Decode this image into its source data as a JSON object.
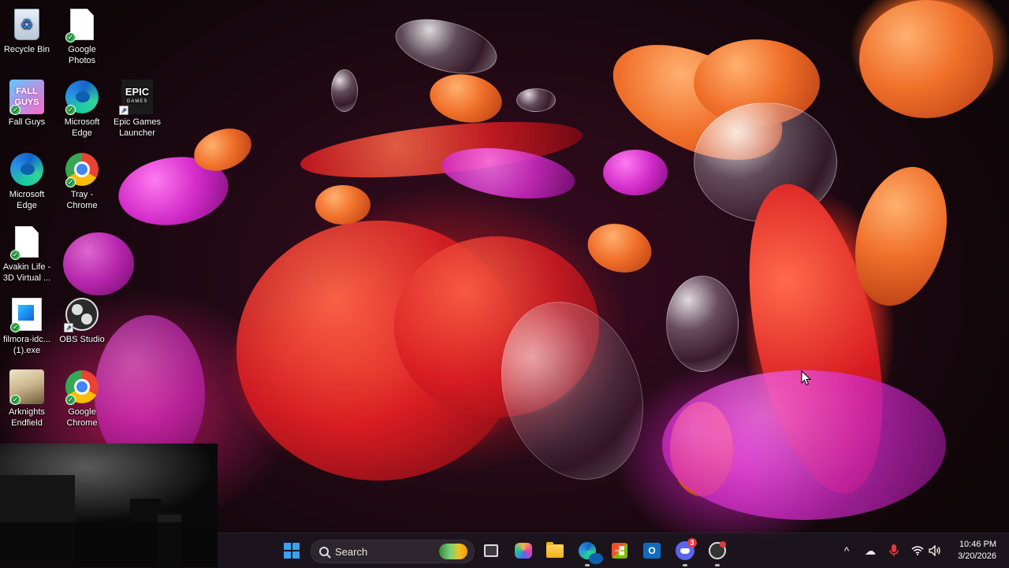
{
  "desktop": {
    "icons": [
      {
        "id": "recycle-bin",
        "label": "Recycle Bin"
      },
      {
        "id": "google-photos",
        "label": "Google Photos"
      },
      {
        "id": "fall-guys",
        "label": "Fall Guys",
        "art_text": "FALL GUYS"
      },
      {
        "id": "microsoft-edge-1",
        "label": "Microsoft Edge"
      },
      {
        "id": "epic-games",
        "label": "Epic Games Launcher",
        "art_text": "EPIC",
        "art_sub": "GAMES"
      },
      {
        "id": "microsoft-edge-2",
        "label": "Microsoft Edge"
      },
      {
        "id": "tray-chrome",
        "label": "Tray - Chrome"
      },
      {
        "id": "avakin-life",
        "label": "Avakin Life - 3D Virtual ..."
      },
      {
        "id": "filmora",
        "label": "filmora-idc... (1).exe"
      },
      {
        "id": "obs-studio",
        "label": "OBS Studio"
      },
      {
        "id": "arknights",
        "label": "Arknights Endfield"
      },
      {
        "id": "google-chrome",
        "label": "Google Chrome"
      }
    ]
  },
  "taskbar": {
    "search_placeholder": "Search",
    "discord_badge": "3",
    "outlook_letter": "O",
    "tray_chevron": "^",
    "clock_time": "10:46 PM",
    "clock_date": "3/20/2026"
  },
  "colors": {
    "accent": "#3aa0f0",
    "taskbar_bg": "#1c161e",
    "badge": "#e8363c"
  }
}
